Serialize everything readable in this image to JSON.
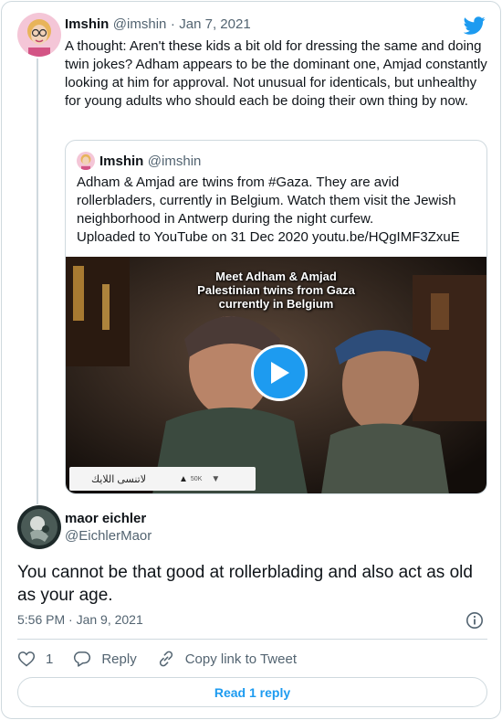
{
  "tweet1": {
    "name": "Imshin",
    "handle": "@imshin",
    "date_sep": "·",
    "date": "Jan 7, 2021",
    "text": "A thought: Aren't these kids a bit old for dressing the same and doing twin jokes? Adham appears to be the dominant one, Amjad constantly looking at him for approval. Not unusual for identicals, but unhealthy for young adults who should each be doing  their own thing by now."
  },
  "quote": {
    "name": "Imshin",
    "handle": "@imshin",
    "line1": "Adham & Amjad are twins from #Gaza. They are avid rollerbladers, currently in Belgium. Watch them visit the Jewish neighborhood in Antwerp during the night curfew.",
    "line2": "Uploaded to YouTube on 31 Dec 2020 youtu.be/HQgIMF3ZxuE",
    "video": {
      "caption_l1": "Meet Adham & Amjad",
      "caption_l2": "Palestinian twins from Gaza",
      "caption_l3": "currently in Belgium",
      "bar_text": "لاتنسى اللايك",
      "likes": "50K"
    }
  },
  "tweet3": {
    "name": "maor eichler",
    "handle": "@EichlerMaor",
    "text": "You cannot be that good at rollerblading and also act as old as your age.",
    "timestamp": "5:56 PM · Jan 9, 2021"
  },
  "actions": {
    "like_count": "1",
    "reply_label": "Reply",
    "copy_label": "Copy link to Tweet"
  },
  "read_reply_label": "Read 1 reply",
  "colors": {
    "accent": "#1d9bf0",
    "text": "#0f1419",
    "secondary": "#536471",
    "border": "#cfd9de"
  }
}
